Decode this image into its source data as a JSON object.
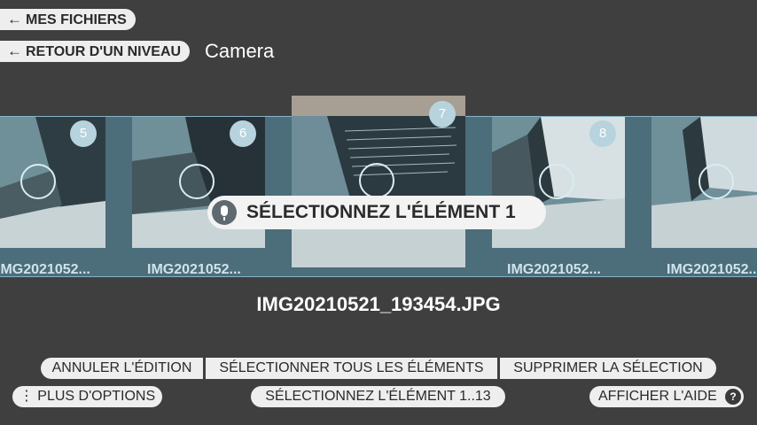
{
  "nav": {
    "back_files_label": "MES FICHIERS",
    "back_level_label": "RETOUR D'UN NIVEAU",
    "folder_title": "Camera"
  },
  "thumbnails": [
    {
      "number": "5",
      "caption": "IMG2021052..."
    },
    {
      "number": "6",
      "caption": "IMG2021052..."
    },
    {
      "number": "7",
      "caption": ""
    },
    {
      "number": "8",
      "caption": "IMG2021052..."
    },
    {
      "number": "",
      "caption": "IMG2021052..."
    }
  ],
  "voice_prompt": "SÉLECTIONNEZ L'ÉLÉMENT 1",
  "current_filename": "IMG20210521_193454.JPG",
  "actions": {
    "cancel_edit": "ANNULER L'ÉDITION",
    "select_all": "SÉLECTIONNER TOUS LES ÉLÉMENTS",
    "clear_selection": "SUPPRIMER LA SÉLECTION",
    "more_options": "PLUS D'OPTIONS",
    "select_range": "SÉLECTIONNEZ L'ÉLÉMENT 1..13",
    "show_help": "AFFICHER L'AIDE"
  },
  "colors": {
    "background": "#3f3f3f",
    "strip": "#4c6d7a",
    "accent": "#86b4c6"
  }
}
